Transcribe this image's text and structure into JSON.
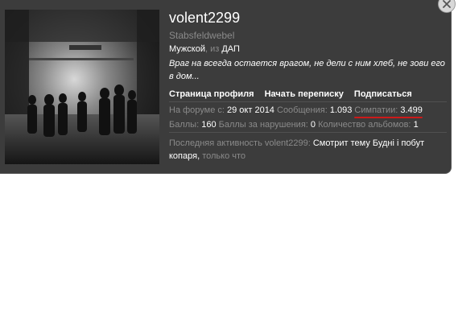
{
  "profile": {
    "username": "volent2299",
    "rank": "Stabsfeldwebel",
    "gender": "Мужской",
    "from_prefix": "из",
    "location": "ДАП",
    "status": "Враг на всегда остается врагом, не дели с ним хлеб, не зови его в дом..."
  },
  "links": {
    "profile_page": "Страница профиля",
    "start_conversation": "Начать переписку",
    "follow": "Подписаться"
  },
  "stats": {
    "joined_label": "На форуме с:",
    "joined_value": "29 окт 2014",
    "messages_label": "Сообщения:",
    "messages_value": "1.093",
    "likes_label": "Симпатии:",
    "likes_value": "3.499",
    "points_label": "Баллы:",
    "points_value": "160",
    "violations_label": "Баллы за нарушения:",
    "violations_value": "0",
    "albums_label": "Количество альбомов:",
    "albums_value": "1"
  },
  "activity": {
    "label": "Последняя активность volent2299:",
    "text": "Смотрит тему Будні і побут копаря,",
    "time": "только что"
  },
  "colors": {
    "card_background": "#3c3c3c",
    "highlight_underline": "#cc1a1a"
  },
  "icons": {
    "close": "close-icon"
  }
}
